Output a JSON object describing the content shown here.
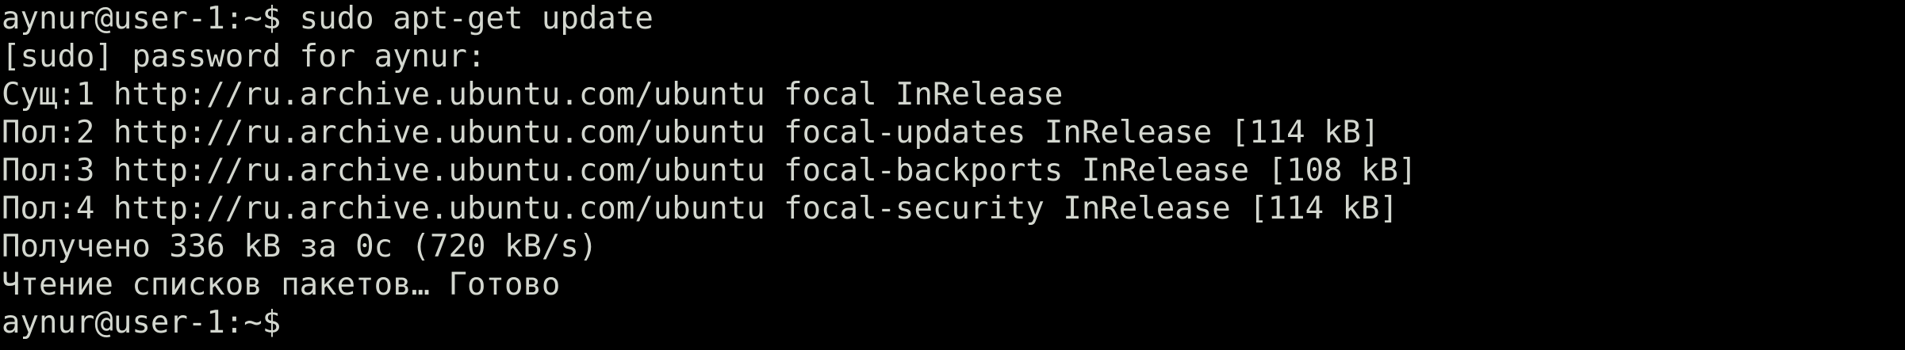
{
  "terminal": {
    "lines": [
      "aynur@user-1:~$ sudo apt-get update",
      "[sudo] password for aynur:",
      "Сущ:1 http://ru.archive.ubuntu.com/ubuntu focal InRelease",
      "Пол:2 http://ru.archive.ubuntu.com/ubuntu focal-updates InRelease [114 kB]",
      "Пол:3 http://ru.archive.ubuntu.com/ubuntu focal-backports InRelease [108 kB]",
      "Пол:4 http://ru.archive.ubuntu.com/ubuntu focal-security InRelease [114 kB]",
      "Получено 336 kB за 0с (720 kB/s)",
      "Чтение списков пакетов… Готово"
    ],
    "prompt": "aynur@user-1:~$ ",
    "colors": {
      "background": "#000000",
      "foreground": "#d3d7cf"
    }
  }
}
